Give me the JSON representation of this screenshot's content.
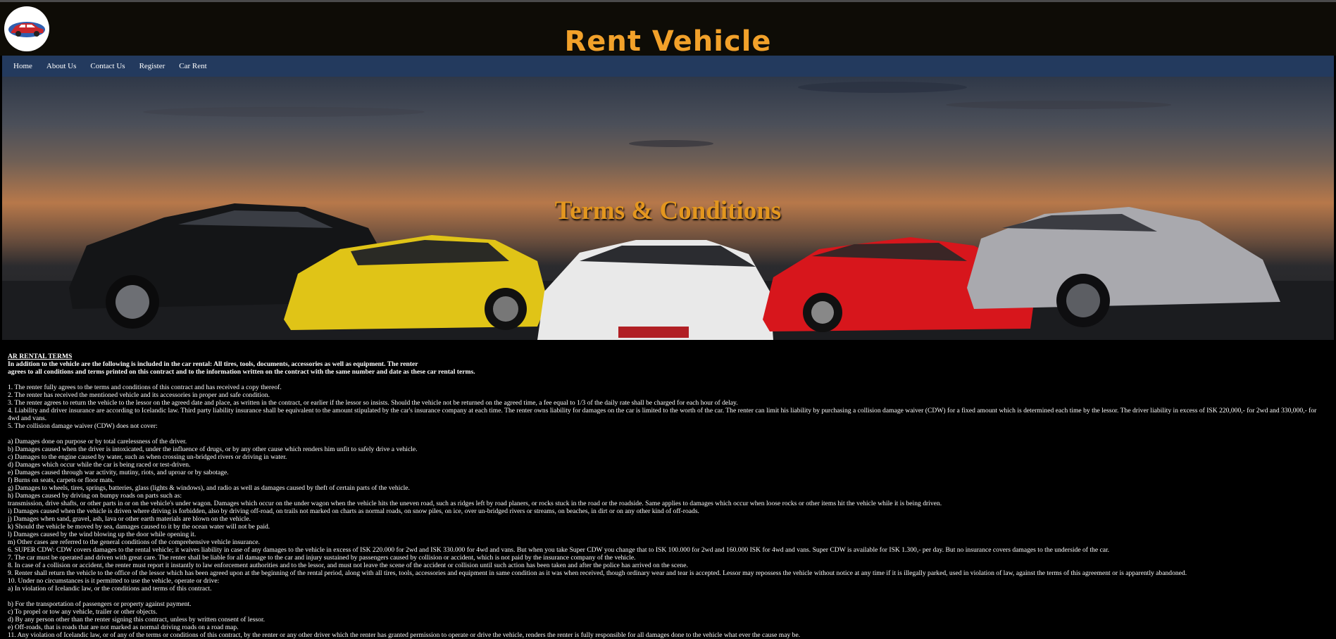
{
  "header": {
    "title": "Rent Vehicle",
    "logo_icon": "car-logo-icon"
  },
  "nav": {
    "items": [
      "Home",
      "About Us",
      "Contact Us",
      "Register",
      "Car Rent"
    ]
  },
  "hero": {
    "title": "Terms & Conditions"
  },
  "colors": {
    "accent": "#f2a12a",
    "nav_bg": "#233a5e",
    "page_bg": "#000000"
  },
  "terms": {
    "heading": "AR RENTAL TERMS",
    "intro_1": "In addition to the vehicle are the following is included in the car rental: All tires, tools, documents, accessories as well as equipment. The renter",
    "intro_2": "agrees to all conditions and terms printed on this contract and to the information written on the contract with the same number and date as these car rental terms.",
    "clauses_1": [
      "1. The renter fully agrees to the terms and conditions of this contract and has received a copy thereof.",
      "2. The renter has received the mentioned vehicle and its accessories in proper and safe condition.",
      "3. The renter agrees to return the vehicle to the lessor on the agreed date and place, as written in the contract, or earlier if the lessor so insists. Should the vehicle not be returned on the agreed time, a fee equal to 1/3 of the daily rate shall be charged for each hour of delay.",
      "4. Liability and driver insurance are according to Icelandic law. Third party liability insurance shall be equivalent to the amount stipulated by the car's insurance company at each time. The renter owns liability for damages on the car is limited to the worth of the car. The renter can limit his liability by purchasing a collision damage waiver (CDW) for a fixed amount which is determined each time by the lessor. The driver liability in excess of ISK 220,000,- for 2wd and 330,000,- for 4wd and vans.",
      "5. The collision damage waiver (CDW) does not cover:"
    ],
    "clauses_2": [
      "a) Damages done on purpose or by total carelessness of the driver.",
      "b) Damages caused when the driver is intoxicated, under the influence of drugs, or by any other cause which renders him unfit to safely drive a vehicle.",
      "c) Damages to the engine caused by water, such as when crossing un-bridged rivers or driving in water.",
      "d) Damages which occur while the car is being raced or test-driven.",
      "e) Damages caused through war activity, mutiny, riots, and uproar or by sabotage.",
      "f) Burns on seats, carpets or floor mats.",
      "g) Damages to wheels, tires, springs, batteries, glass (lights & windows), and radio as well as damages caused by theft of certain parts of the vehicle.",
      "h) Damages caused by driving on bumpy roads on parts such as:",
      "transmission, drive shafts, or other parts in or on the vehicle's under wagon. Damages which occur on the under wagon when the vehicle hits the uneven road, such as ridges left by road planers, or rocks stuck in the road or the roadside. Same applies to damages which occur when loose rocks or other items hit the vehicle while it is being driven.",
      "i) Damages caused when the vehicle is driven where driving is forbidden, also by driving off-road, on trails not marked on charts as normal roads, on snow piles, on ice, over un-bridged rivers or streams, on beaches, in dirt or on any other kind of off-roads.",
      "j) Damages when sand, gravel, ash, lava or other earth materials are blown on the vehicle.",
      "k) Should the vehicle be moved by sea, damages caused to it by the ocean water will not be paid.",
      "l) Damages caused by the wind blowing up the door while opening it.",
      "m) Other cases are referred to the general conditions of the comprehensive vehicle insurance.",
      "6. SUPER CDW: CDW covers damages to the rental vehicle; it waives liability in case of any damages to the vehicle in excess of ISK 220.000 for 2wd and ISK 330.000 for 4wd and vans. But when you take Super CDW you change that to ISK 100.000 for 2wd and 160.000 ISK for 4wd and vans. Super CDW is available for ISK 1.300,- per day. But no insurance covers damages to the underside of the car.",
      "7. The car must be operated and driven with great care. The renter shall be liable for all damage to the car and injury sustained by passengers caused by collision or accident, which is not paid by the insurance company of the vehicle.",
      "8. In case of a collision or accident, the renter must report it instantly to law enforcement authorities and to the lessor, and must not leave the scene of the accident or collision until such action has been taken and after the police has arrived on the scene.",
      "9. Renter shall return the vehicle to the office of the lessor which has been agreed upon at the beginning of the rental period, along with all tires, tools, accessories and equipment in same condition as it was when received, though ordinary wear and tear is accepted. Lessor may repossess the vehicle without notice at any time if it is illegally parked, used in violation of law, against the terms of this agreement or is apparently abandoned.",
      "10. Under no circumstances is it permitted to use the vehicle, operate or drive:",
      "a) In violation of Icelandic law, or the conditions and terms of this contract."
    ],
    "clauses_3": [
      "b) For the transportation of passengers or property against payment.",
      "c) To propel or tow any vehicle, trailer or other objects.",
      "d) By any person other than the renter signing this contract, unless by written consent of lessor.",
      "e) Off-roads, that is roads that are not marked as normal driving roads on a road map.",
      "11. Any violation of Icelandic law, or of any of the terms or conditions of this contract, by the renter or any other driver which the renter has granted permission to operate or drive the vehicle, renders the renter is fully responsible for all damages done to the vehicle what ever the cause may be."
    ]
  }
}
